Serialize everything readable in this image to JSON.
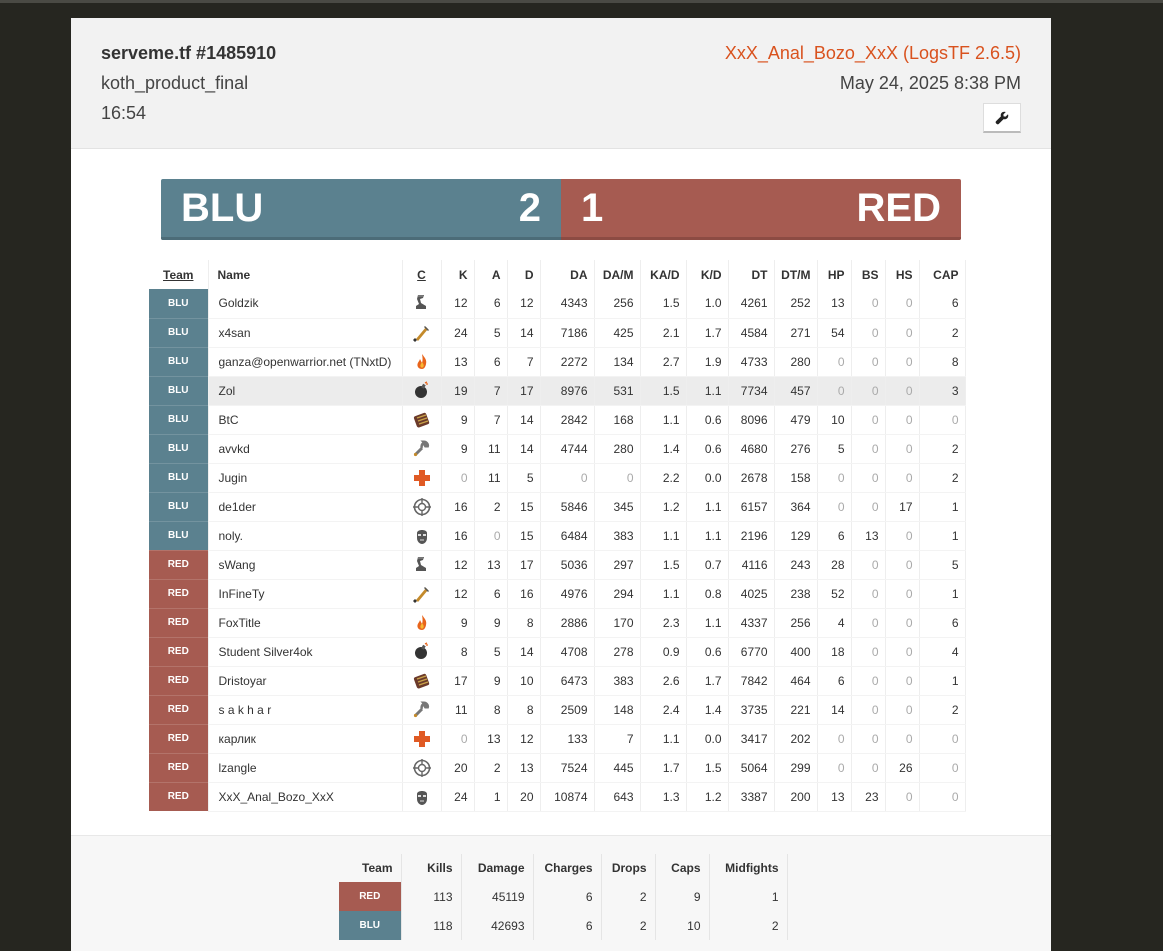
{
  "header": {
    "title": "serveme.tf #1485910",
    "map": "koth_product_final",
    "duration": "16:54",
    "uploader": "XxX_Anal_Bozo_XxX (LogsTF 2.6.5)",
    "date": "May 24, 2025 8:38 PM",
    "tool_icon": "wrench-icon"
  },
  "score": {
    "blu_label": "BLU",
    "blu_score": "2",
    "red_score": "1",
    "red_label": "RED"
  },
  "colors": {
    "blu": "#5b818f",
    "red": "#a65b51",
    "accent": "#d9521e"
  },
  "columns": [
    "Team",
    "Name",
    "C",
    "K",
    "A",
    "D",
    "DA",
    "DA/M",
    "KA/D",
    "K/D",
    "DT",
    "DT/M",
    "HP",
    "BS",
    "HS",
    "CAP"
  ],
  "players": [
    {
      "team": "BLU",
      "name": "Goldzik",
      "cls": "scout",
      "k": "12",
      "a": "6",
      "d": "12",
      "da": "4343",
      "dam": "256",
      "kad": "1.5",
      "kd": "1.0",
      "dt": "4261",
      "dtm": "252",
      "hp": "13",
      "bs": "0",
      "hs": "0",
      "cap": "6"
    },
    {
      "team": "BLU",
      "name": "x4san",
      "cls": "soldier",
      "k": "24",
      "a": "5",
      "d": "14",
      "da": "7186",
      "dam": "425",
      "kad": "2.1",
      "kd": "1.7",
      "dt": "4584",
      "dtm": "271",
      "hp": "54",
      "bs": "0",
      "hs": "0",
      "cap": "2"
    },
    {
      "team": "BLU",
      "name": "ganza@openwarrior.net (TNxtD)",
      "cls": "pyro",
      "k": "13",
      "a": "6",
      "d": "7",
      "da": "2272",
      "dam": "134",
      "kad": "2.7",
      "kd": "1.9",
      "dt": "4733",
      "dtm": "280",
      "hp": "0",
      "bs": "0",
      "hs": "0",
      "cap": "8"
    },
    {
      "team": "BLU",
      "name": "Zol",
      "cls": "demoman",
      "k": "19",
      "a": "7",
      "d": "17",
      "da": "8976",
      "dam": "531",
      "kad": "1.5",
      "kd": "1.1",
      "dt": "7734",
      "dtm": "457",
      "hp": "0",
      "bs": "0",
      "hs": "0",
      "cap": "3"
    },
    {
      "team": "BLU",
      "name": "BtC",
      "cls": "heavy",
      "k": "9",
      "a": "7",
      "d": "14",
      "da": "2842",
      "dam": "168",
      "kad": "1.1",
      "kd": "0.6",
      "dt": "8096",
      "dtm": "479",
      "hp": "10",
      "bs": "0",
      "hs": "0",
      "cap": "0"
    },
    {
      "team": "BLU",
      "name": "avvkd",
      "cls": "engineer",
      "k": "9",
      "a": "11",
      "d": "14",
      "da": "4744",
      "dam": "280",
      "kad": "1.4",
      "kd": "0.6",
      "dt": "4680",
      "dtm": "276",
      "hp": "5",
      "bs": "0",
      "hs": "0",
      "cap": "2"
    },
    {
      "team": "BLU",
      "name": "Jugin",
      "cls": "medic",
      "k": "0",
      "a": "11",
      "d": "5",
      "da": "0",
      "dam": "0",
      "kad": "2.2",
      "kd": "0.0",
      "dt": "2678",
      "dtm": "158",
      "hp": "0",
      "bs": "0",
      "hs": "0",
      "cap": "2"
    },
    {
      "team": "BLU",
      "name": "de1der",
      "cls": "sniper",
      "k": "16",
      "a": "2",
      "d": "15",
      "da": "5846",
      "dam": "345",
      "kad": "1.2",
      "kd": "1.1",
      "dt": "6157",
      "dtm": "364",
      "hp": "0",
      "bs": "0",
      "hs": "17",
      "cap": "1"
    },
    {
      "team": "BLU",
      "name": "noly.",
      "cls": "spy",
      "k": "16",
      "a": "0",
      "d": "15",
      "da": "6484",
      "dam": "383",
      "kad": "1.1",
      "kd": "1.1",
      "dt": "2196",
      "dtm": "129",
      "hp": "6",
      "bs": "13",
      "hs": "0",
      "cap": "1"
    },
    {
      "team": "RED",
      "name": "sWang",
      "cls": "scout",
      "k": "12",
      "a": "13",
      "d": "17",
      "da": "5036",
      "dam": "297",
      "kad": "1.5",
      "kd": "0.7",
      "dt": "4116",
      "dtm": "243",
      "hp": "28",
      "bs": "0",
      "hs": "0",
      "cap": "5"
    },
    {
      "team": "RED",
      "name": "InFineTy",
      "cls": "soldier",
      "k": "12",
      "a": "6",
      "d": "16",
      "da": "4976",
      "dam": "294",
      "kad": "1.1",
      "kd": "0.8",
      "dt": "4025",
      "dtm": "238",
      "hp": "52",
      "bs": "0",
      "hs": "0",
      "cap": "1"
    },
    {
      "team": "RED",
      "name": "FoxTitle",
      "cls": "pyro",
      "k": "9",
      "a": "9",
      "d": "8",
      "da": "2886",
      "dam": "170",
      "kad": "2.3",
      "kd": "1.1",
      "dt": "4337",
      "dtm": "256",
      "hp": "4",
      "bs": "0",
      "hs": "0",
      "cap": "6"
    },
    {
      "team": "RED",
      "name": "Student Silver4ok",
      "cls": "demoman",
      "k": "8",
      "a": "5",
      "d": "14",
      "da": "4708",
      "dam": "278",
      "kad": "0.9",
      "kd": "0.6",
      "dt": "6770",
      "dtm": "400",
      "hp": "18",
      "bs": "0",
      "hs": "0",
      "cap": "4"
    },
    {
      "team": "RED",
      "name": "Dristoyar",
      "cls": "heavy",
      "k": "17",
      "a": "9",
      "d": "10",
      "da": "6473",
      "dam": "383",
      "kad": "2.6",
      "kd": "1.7",
      "dt": "7842",
      "dtm": "464",
      "hp": "6",
      "bs": "0",
      "hs": "0",
      "cap": "1"
    },
    {
      "team": "RED",
      "name": "s a k h a r",
      "cls": "engineer",
      "k": "11",
      "a": "8",
      "d": "8",
      "da": "2509",
      "dam": "148",
      "kad": "2.4",
      "kd": "1.4",
      "dt": "3735",
      "dtm": "221",
      "hp": "14",
      "bs": "0",
      "hs": "0",
      "cap": "2"
    },
    {
      "team": "RED",
      "name": "карлик",
      "cls": "medic",
      "k": "0",
      "a": "13",
      "d": "12",
      "da": "133",
      "dam": "7",
      "kad": "1.1",
      "kd": "0.0",
      "dt": "3417",
      "dtm": "202",
      "hp": "0",
      "bs": "0",
      "hs": "0",
      "cap": "0"
    },
    {
      "team": "RED",
      "name": "lzangle",
      "cls": "sniper",
      "k": "20",
      "a": "2",
      "d": "13",
      "da": "7524",
      "dam": "445",
      "kad": "1.7",
      "kd": "1.5",
      "dt": "5064",
      "dtm": "299",
      "hp": "0",
      "bs": "0",
      "hs": "26",
      "cap": "0"
    },
    {
      "team": "RED",
      "name": "XxX_Anal_Bozo_XxX",
      "cls": "spy",
      "k": "24",
      "a": "1",
      "d": "20",
      "da": "10874",
      "dam": "643",
      "kad": "1.3",
      "kd": "1.2",
      "dt": "3387",
      "dtm": "200",
      "hp": "13",
      "bs": "23",
      "hs": "0",
      "cap": "0"
    }
  ],
  "summary": {
    "columns": [
      "Team",
      "Kills",
      "Damage",
      "Charges",
      "Drops",
      "Caps",
      "Midfights"
    ],
    "rows": [
      {
        "team": "RED",
        "kills": "113",
        "damage": "45119",
        "charges": "6",
        "drops": "2",
        "caps": "9",
        "midfights": "1"
      },
      {
        "team": "BLU",
        "kills": "118",
        "damage": "42693",
        "charges": "6",
        "drops": "2",
        "caps": "10",
        "midfights": "2"
      }
    ]
  }
}
